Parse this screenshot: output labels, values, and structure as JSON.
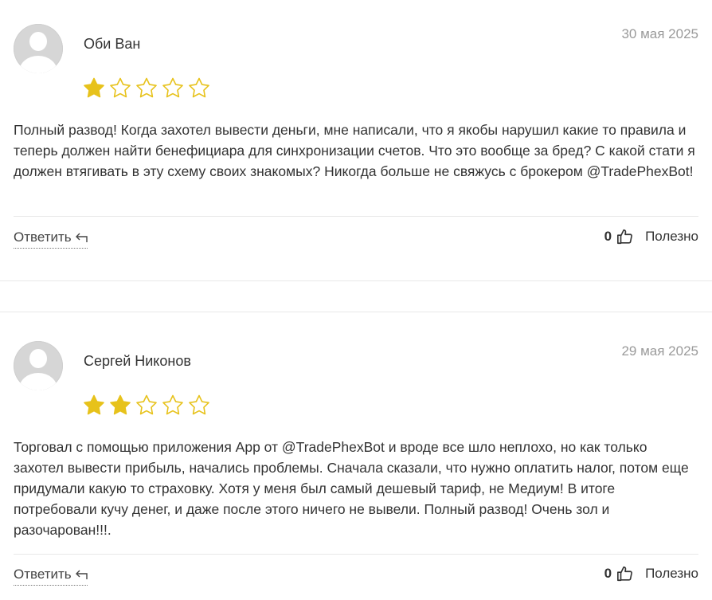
{
  "reviews": [
    {
      "author": "Оби Ван",
      "date": "30 мая 2025",
      "rating": 1,
      "max_rating": 5,
      "text": "Полный развод! Когда захотел вывести деньги, мне написали, что я якобы нарушил какие то правила и теперь должен найти бенефициара для синхронизации счетов. Что это вообще за бред? С какой стати я должен втягивать в эту схему своих знакомых? Никогда больше не свяжусь с брокером @TradePhexBot!",
      "reply_label": "Ответить",
      "helpful_count": "0",
      "helpful_label": "Полезно"
    },
    {
      "author": "Сергей Никонов",
      "date": "29 мая 2025",
      "rating": 2,
      "max_rating": 5,
      "text": "Торговал с помощью приложения App от @TradePhexBot и вроде все шло неплохо, но как только захотел вывести прибыль, начались проблемы. Сначала сказали, что нужно оплатить налог, потом еще придумали какую то страховку. Хотя у меня был самый дешевый тариф, не Медиум! В итоге потребовали кучу денег, и даже после этого ничего не вывели. Полный развод! Очень зол и разочарован!!!.",
      "reply_label": "Ответить",
      "helpful_count": "0",
      "helpful_label": "Полезно"
    }
  ],
  "colors": {
    "star_fill": "#e7c21b",
    "star_outline": "#e7c21b",
    "date_text": "#9a9a9a",
    "divider": "#e8e8e8"
  },
  "icons": {
    "avatar": "user-placeholder-icon",
    "reply": "reply-arrow-icon",
    "helpful": "thumbs-up-icon",
    "star": "star-icon"
  }
}
